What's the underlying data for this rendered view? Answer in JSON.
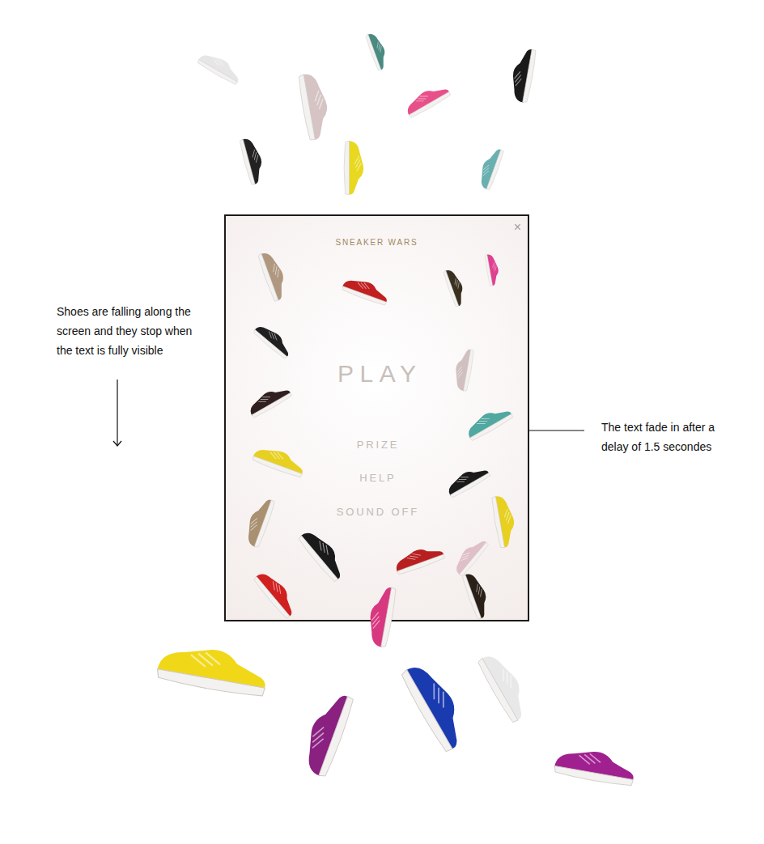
{
  "annotations": [
    {
      "text": "Shoes are falling along the screen and they stop when the text is fully visible"
    },
    {
      "text": "The text fade in after a delay of 1.5 secondes"
    }
  ],
  "screen": {
    "title": "SNEAKER WARS",
    "close": "×",
    "menu": [
      {
        "label": "PLAY"
      },
      {
        "label": "PRIZE"
      },
      {
        "label": "HELP"
      },
      {
        "label": "SOUND OFF"
      }
    ]
  },
  "shoes": [
    {
      "color": "#e6e6e6"
    },
    {
      "color": "#d6c4c4"
    },
    {
      "color": "#4a8a80"
    },
    {
      "color": "#e8508a"
    },
    {
      "color": "#1a1a1a"
    },
    {
      "color": "#222222"
    },
    {
      "color": "#e8d820"
    },
    {
      "color": "#6ab0b0"
    },
    {
      "color": "#b09880"
    },
    {
      "color": "#c02020"
    },
    {
      "color": "#3a3020"
    },
    {
      "color": "#e04090"
    },
    {
      "color": "#202020"
    },
    {
      "color": "#d0c0c0"
    },
    {
      "color": "#302020"
    },
    {
      "color": "#50a8a0"
    },
    {
      "color": "#e8d020"
    },
    {
      "color": "#1a1a1a"
    },
    {
      "color": "#a89070"
    },
    {
      "color": "#1a1a1a"
    },
    {
      "color": "#e8d020"
    },
    {
      "color": "#b82020"
    },
    {
      "color": "#e0c0c8"
    },
    {
      "color": "#d02020"
    },
    {
      "color": "#2a2018"
    },
    {
      "color": "#d83880"
    },
    {
      "color": "#f0d818"
    },
    {
      "color": "#8a2080"
    },
    {
      "color": "#1a3ab0"
    },
    {
      "color": "#e8e8e8"
    },
    {
      "color": "#a02090"
    }
  ]
}
